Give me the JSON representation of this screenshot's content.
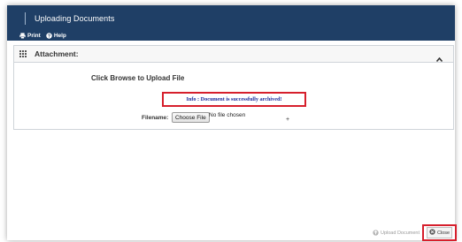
{
  "window": {
    "title": "Uploading Documents"
  },
  "toolbar": {
    "print_label": "Print",
    "print_icon": "print-icon",
    "help_label": "Help",
    "help_icon": "help-icon"
  },
  "panel": {
    "title": "Attachment:",
    "heading": "Click Browse to Upload File",
    "info_message": "Info :  Document is successfully archived!",
    "filename_label": "Filename:",
    "choose_file_label": "Choose File",
    "no_file_text": "No file chosen"
  },
  "footer": {
    "upload_label": "Upload Document",
    "close_label": "Close"
  },
  "colors": {
    "titlebar": "#1f3f66",
    "highlight": "#d61f2c",
    "info_text": "#1b2a9c"
  }
}
